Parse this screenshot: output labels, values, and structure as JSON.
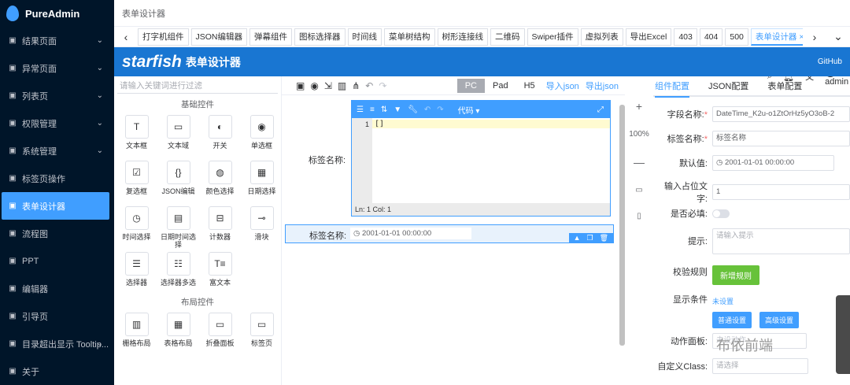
{
  "app": {
    "name": "PureAdmin"
  },
  "sidebar": {
    "items": [
      {
        "label": "结果页面",
        "chevron": true
      },
      {
        "label": "异常页面",
        "chevron": true
      },
      {
        "label": "列表页",
        "chevron": true
      },
      {
        "label": "权限管理",
        "chevron": true
      },
      {
        "label": "系统管理",
        "chevron": true
      },
      {
        "label": "标签页操作",
        "chevron": false
      },
      {
        "label": "表单设计器",
        "chevron": false,
        "active": true
      },
      {
        "label": "流程图",
        "chevron": false
      },
      {
        "label": "PPT",
        "chevron": false
      },
      {
        "label": "编辑器",
        "chevron": false
      },
      {
        "label": "引导页",
        "chevron": false
      },
      {
        "label": "目录超出显示 Tooltip...",
        "chevron": true
      },
      {
        "label": "关于",
        "chevron": false
      }
    ]
  },
  "topbar": {
    "breadcrumb": "表单设计器",
    "notif_count": "13",
    "user": "admin"
  },
  "tabs": [
    "打字机组件",
    "JSON编辑器",
    "弹幕组件",
    "图标选择器",
    "时间线",
    "菜单树结构",
    "树形连接线",
    "二维码",
    "Swiper插件",
    "虚拟列表",
    "导出Excel",
    "403",
    "404",
    "500",
    "表单设计器 ×"
  ],
  "header": {
    "brand": "starfish",
    "sub": "表单设计器",
    "github": "GitHub"
  },
  "left": {
    "search_placeholder": "请输入关键词进行过滤",
    "basic_title": "基础控件",
    "basic": [
      {
        "icon": "T",
        "label": "文本框"
      },
      {
        "icon": "▭",
        "label": "文本域"
      },
      {
        "icon": "◐",
        "label": "开关"
      },
      {
        "icon": "◉",
        "label": "单选框"
      },
      {
        "icon": "☑",
        "label": "复选框"
      },
      {
        "icon": "{}",
        "label": "JSON编辑"
      },
      {
        "icon": "◍",
        "label": "颜色选择"
      },
      {
        "icon": "▦",
        "label": "日期选择"
      },
      {
        "icon": "◷",
        "label": "时间选择"
      },
      {
        "icon": "▤",
        "label": "日期时间选择"
      },
      {
        "icon": "⊟",
        "label": "计数器"
      },
      {
        "icon": "⊸",
        "label": "滑块"
      },
      {
        "icon": "☰",
        "label": "选择器"
      },
      {
        "icon": "☷",
        "label": "选择器多选"
      },
      {
        "icon": "T≡",
        "label": "富文本"
      }
    ],
    "layout_title": "布局控件",
    "layout": [
      {
        "icon": "▥",
        "label": "栅格布局"
      },
      {
        "icon": "▦",
        "label": "表格布局"
      },
      {
        "icon": "▭",
        "label": "折叠面板"
      },
      {
        "icon": "▭",
        "label": "标签页"
      }
    ]
  },
  "canvas": {
    "devices": [
      "PC",
      "Pad",
      "H5"
    ],
    "import": "导入json",
    "export": "导出json",
    "field1_label": "标签名称:",
    "code_btn": "代码 ▾",
    "code_line_no": "1",
    "code_text": "[]",
    "status": "Ln: 1    Col: 1",
    "field2_label": "标签名称:",
    "date_value": "2001-01-01 00:00:00"
  },
  "zoom": "100%",
  "right": {
    "tabs": [
      "组件配置",
      "JSON配置",
      "表单配置"
    ],
    "field_name_label": "字段名称:",
    "field_name_value": "DateTime_K2u-o1ZtOrHz5yO3oB-2",
    "label_name_label": "标签名称:",
    "label_name_value": "标签名称",
    "default_label": "默认值:",
    "default_value": "2001-01-01 00:00:00",
    "placeholder_label": "输入占位文字:",
    "placeholder_value": "1",
    "required_label": "是否必填:",
    "hint_label": "提示:",
    "hint_placeholder": "请输入提示",
    "rule_label": "校验规则",
    "rule_btn": "新增规则",
    "cond_label": "显示条件",
    "cond_value": "未设置",
    "normal_btn": "普通设置",
    "adv_btn": "高级设置",
    "action_label": "动作面板:",
    "action_value": "未设动作",
    "class_label": "自定义Class:",
    "class_placeholder": "请选择"
  },
  "watermark": "布依前端"
}
